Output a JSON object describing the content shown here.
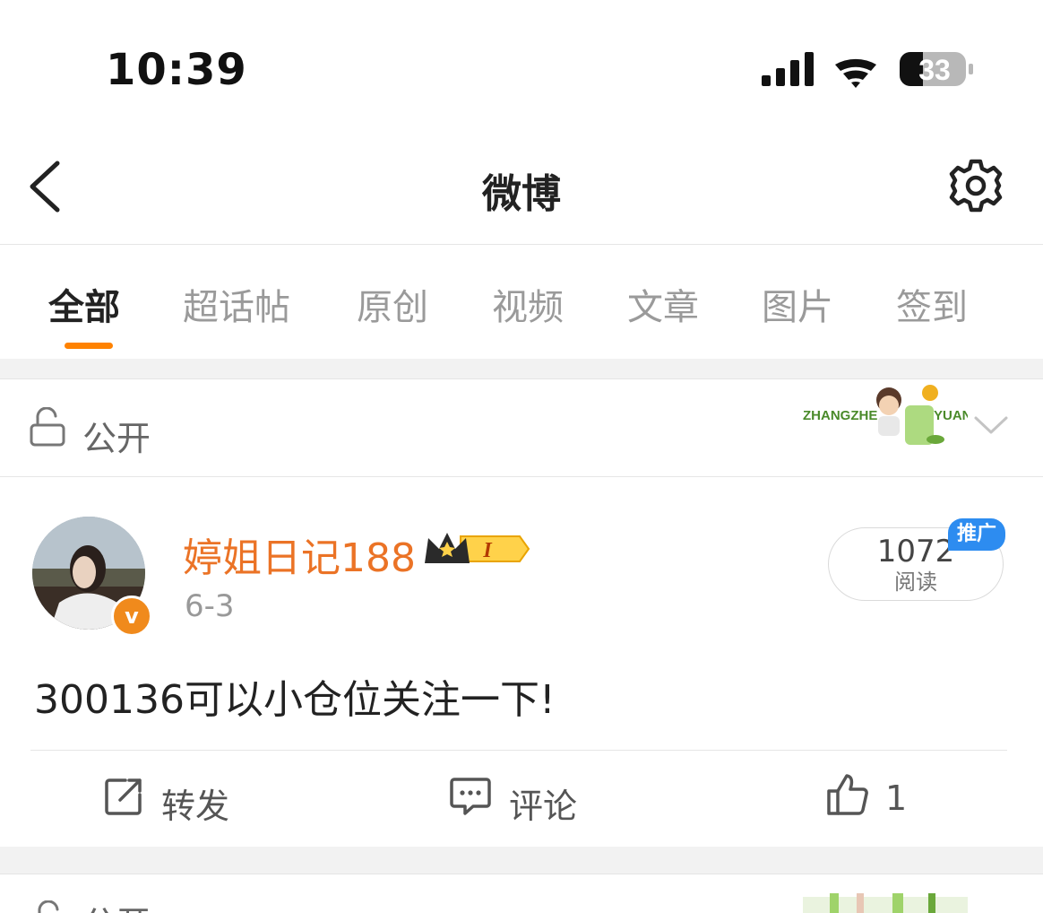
{
  "status_bar": {
    "time": "10:39",
    "battery": "33"
  },
  "nav": {
    "title": "微博"
  },
  "tabs": [
    {
      "label": "全部",
      "active": true
    },
    {
      "label": "超话帖"
    },
    {
      "label": "原创"
    },
    {
      "label": "视频"
    },
    {
      "label": "文章"
    },
    {
      "label": "图片"
    },
    {
      "label": "签到"
    }
  ],
  "post": {
    "visibility": "公开",
    "decoration_text": {
      "left": "ZHANGZHE",
      "right": "YUAN"
    },
    "author": {
      "name": "婷姐日记188",
      "verified_mark": "v",
      "vip_level": "I"
    },
    "date": "6-3",
    "reads": {
      "count": "1072",
      "label": "阅读",
      "badge": "推广"
    },
    "text": "300136可以小仓位关注一下!",
    "actions": {
      "repost": "转发",
      "comment": "评论",
      "like_count": "1"
    }
  },
  "colors": {
    "accent": "#ff8200",
    "username": "#eb7326",
    "promo": "#2d8cf0"
  },
  "next_post": {
    "visibility": "公开"
  }
}
